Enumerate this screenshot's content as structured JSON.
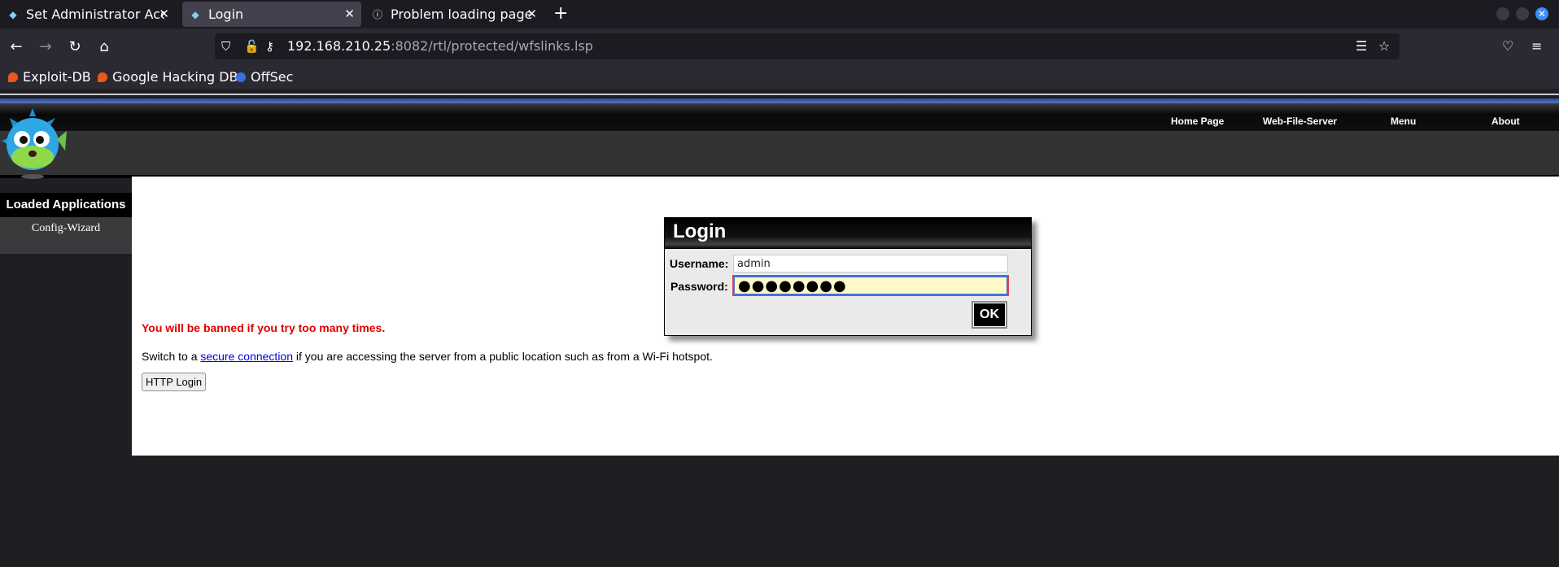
{
  "browser": {
    "tabs": [
      {
        "title": "Set Administrator Acco",
        "active": false
      },
      {
        "title": "Login",
        "active": true
      },
      {
        "title": "Problem loading page",
        "active": false
      }
    ],
    "url": {
      "host": "192.168.210.25",
      "rest": ":8082/rtl/protected/wfslinks.lsp"
    },
    "bookmarks": [
      {
        "label": "Exploit-DB",
        "icon_color": "#e8591a"
      },
      {
        "label": "Google Hacking DB",
        "icon_color": "#e8591a"
      },
      {
        "label": "OffSec",
        "icon_color": "#3a6fe0"
      }
    ]
  },
  "site": {
    "nav": [
      "Home Page",
      "Web-File-Server",
      "Menu",
      "About"
    ],
    "sidebar": {
      "title": "Loaded Applications",
      "items": [
        "Config-Wizard"
      ]
    }
  },
  "login": {
    "title": "Login",
    "username_label": "Username:",
    "username_value": "admin",
    "password_label": "Password:",
    "password_value": "●●●●●●●●",
    "ok_label": "OK"
  },
  "notice": {
    "warning": "You will be banned if you try too many times.",
    "switch_prefix": "Switch to a ",
    "switch_link": "secure connection",
    "switch_suffix": " if you are accessing the server from a public location such as from a Wi-Fi hotspot.",
    "http_login_label": "HTTP Login"
  },
  "colors": {
    "accent_blue": "#4a6ed6",
    "warning_red": "#e00000"
  }
}
